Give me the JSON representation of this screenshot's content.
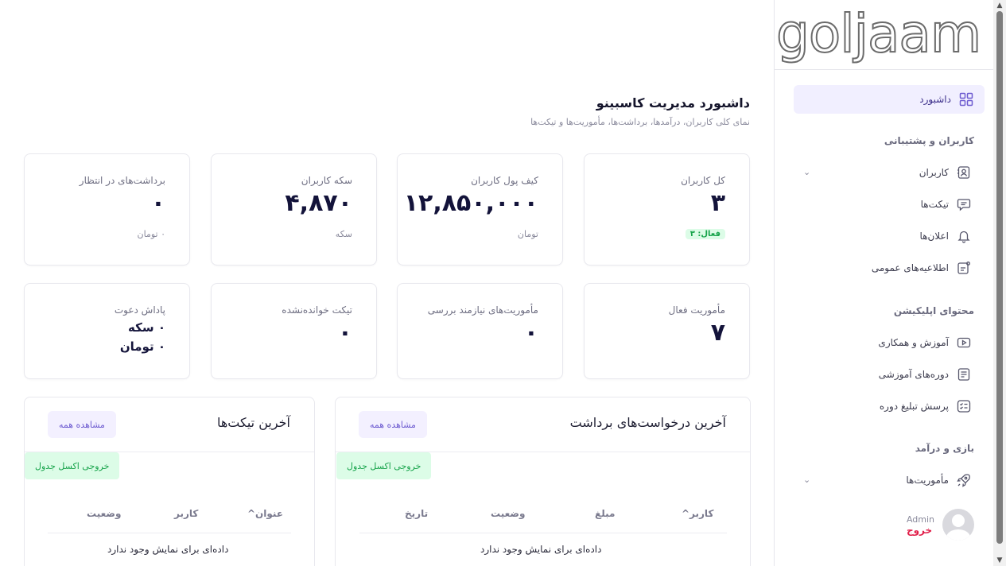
{
  "brand": {
    "logo_text": "goljaam"
  },
  "sidebar": {
    "active_item": {
      "label": "داشبورد",
      "icon": "grid-icon"
    },
    "sections": [
      {
        "title": "کاربران و پشتیبانی",
        "items": [
          {
            "label": "کاربران",
            "icon": "user-card-icon",
            "has_submenu": true
          },
          {
            "label": "تیکت‌ها",
            "icon": "chat-bubble-icon"
          },
          {
            "label": "اعلان‌ها",
            "icon": "bell-icon"
          },
          {
            "label": "اطلاعیه‌های عمومی",
            "icon": "announcement-icon"
          }
        ]
      },
      {
        "title": "محتوای اپلیکیشن",
        "items": [
          {
            "label": "آموزش و همکاری",
            "icon": "video-icon"
          },
          {
            "label": "دوره‌های آموزشی",
            "icon": "course-icon"
          },
          {
            "label": "پرسش تبلیغ دوره",
            "icon": "checklist-icon"
          }
        ]
      },
      {
        "title": "بازی و درآمد",
        "items": [
          {
            "label": "مأموریت‌ها",
            "icon": "rocket-icon",
            "has_submenu": true
          }
        ]
      }
    ],
    "profile": {
      "name": "Admin",
      "logout_label": "خروج"
    }
  },
  "header": {
    "title": "داشبورد مدیریت کاسبینو",
    "subtitle": "نمای کلی کاربران، درآمدها، برداشت‌ها، مأموریت‌ها و تیکت‌ها"
  },
  "stats_row1": [
    {
      "label": "کل کاربران",
      "value": "۳",
      "badge": "فعال: ۳"
    },
    {
      "label": "کیف پول کاربران",
      "value": "۱۲,۸۵۰,۰۰۰",
      "unit": "تومان"
    },
    {
      "label": "سکه کاربران",
      "value": "۴,۸۷۰",
      "unit": "سکه"
    },
    {
      "label": "برداشت‌های در انتظار",
      "value": "۰",
      "unit": "۰ تومان"
    }
  ],
  "stats_row2": [
    {
      "label": "مأموریت فعال",
      "value": "۷"
    },
    {
      "label": "مأموریت‌های نیازمند بررسی",
      "value": "۰"
    },
    {
      "label": "تیکت خوانده‌نشده",
      "value": "۰"
    },
    {
      "label": "پاداش دعوت",
      "line1": "۰ سکه",
      "line2": "۰ تومان"
    }
  ],
  "withdrawals_panel": {
    "title": "آخرین درخواست‌های برداشت",
    "view_all": "مشاهده همه",
    "excel": "خروجی اکسل جدول",
    "columns": [
      "کاربر^",
      "مبلغ",
      "وضعیت",
      "تاریخ"
    ],
    "empty": "داده‌ای برای نمایش وجود ندارد"
  },
  "tickets_panel": {
    "title": "آخرین تیکت‌ها",
    "view_all": "مشاهده همه",
    "excel": "خروجی اکسل جدول",
    "columns": [
      "عنوان^",
      "کاربر",
      "وضعیت"
    ],
    "empty": "داده‌ای برای نمایش وجود ندارد"
  },
  "colors": {
    "accent": "#6d5bd0",
    "active_bg": "#f1efff",
    "success": "#16a34a",
    "danger": "#e11d48"
  }
}
